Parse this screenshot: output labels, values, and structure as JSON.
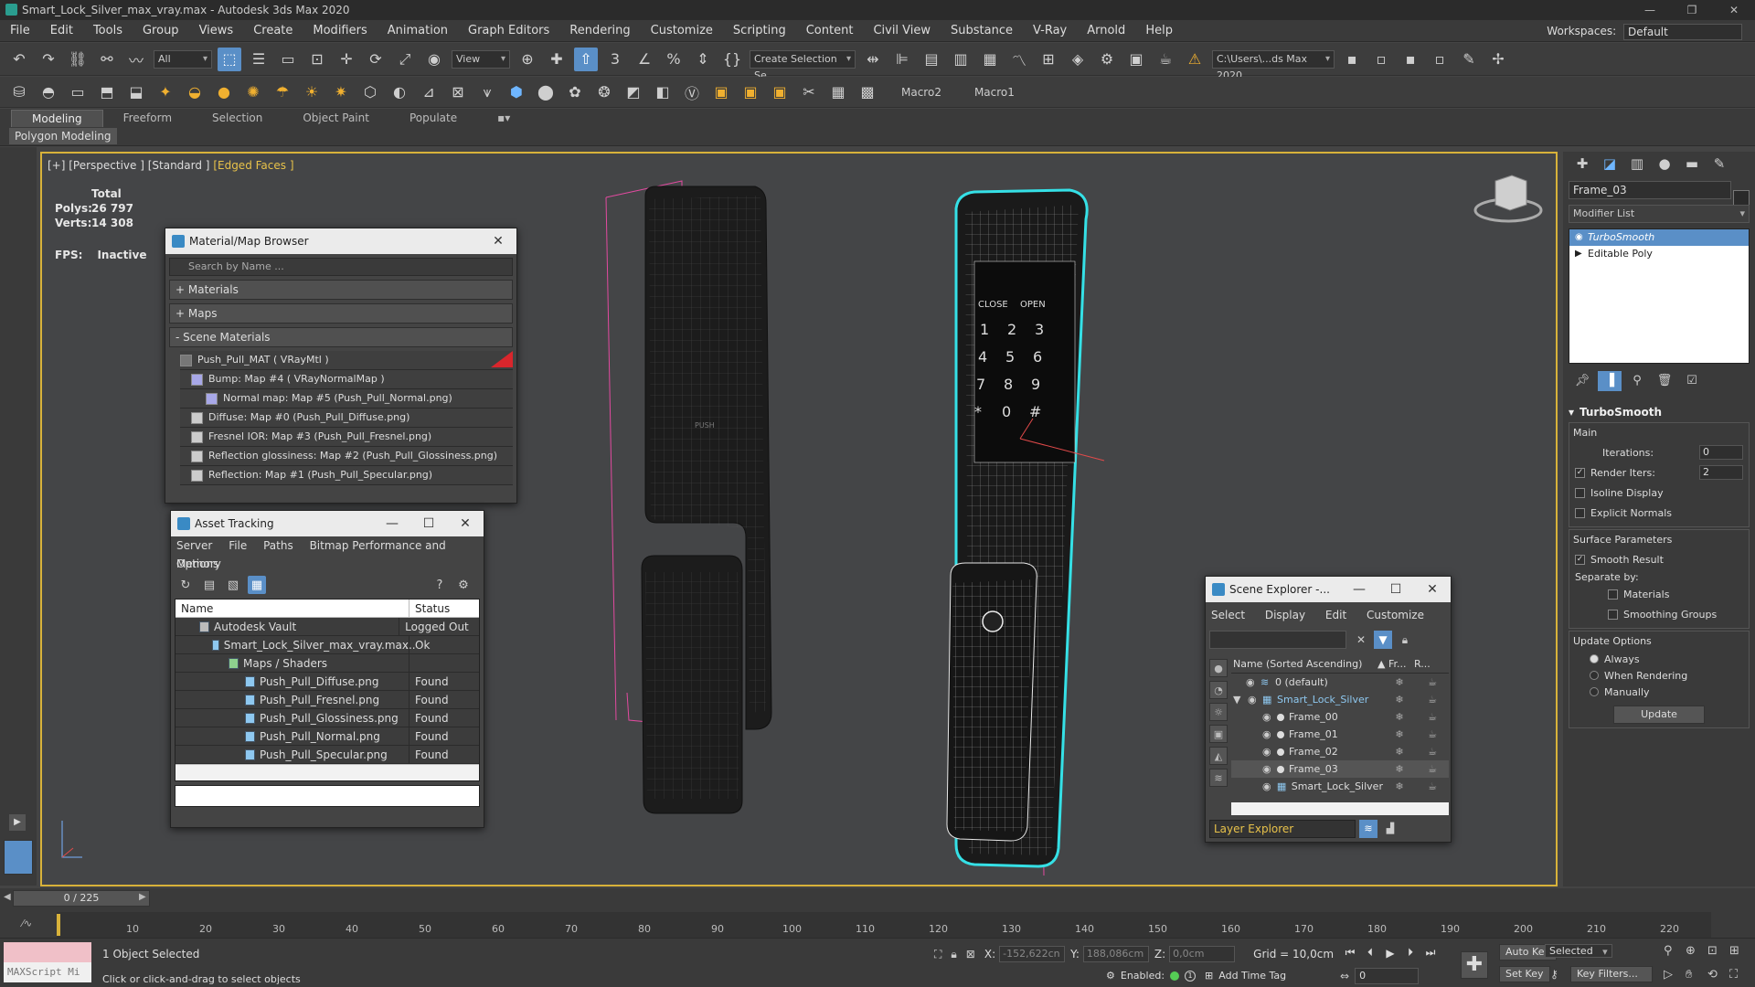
{
  "window": {
    "title": "Smart_Lock_Silver_max_vray.max - Autodesk 3ds Max 2020",
    "controls": [
      "—",
      "❐",
      "✕"
    ]
  },
  "menu": {
    "items": [
      "File",
      "Edit",
      "Tools",
      "Group",
      "Views",
      "Create",
      "Modifiers",
      "Animation",
      "Graph Editors",
      "Rendering",
      "Customize",
      "Scripting",
      "Content",
      "Civil View",
      "Substance",
      "V-Ray",
      "Arnold",
      "Help"
    ],
    "workspace_label": "Workspaces:",
    "workspace_value": "Default"
  },
  "toolbar": {
    "filter": "All",
    "view": "View",
    "selection_set": "Create Selection Se",
    "path": "C:\\Users\\...ds Max 2020",
    "macro1": "Macro2",
    "macro2": "Macro1"
  },
  "ribbon": {
    "tabs": [
      "Modeling",
      "Freeform",
      "Selection",
      "Object Paint",
      "Populate"
    ],
    "panel": "Polygon Modeling"
  },
  "viewport": {
    "label_prefix": "[+] [Perspective ] [Standard ] ",
    "label_mode": "[Edged Faces ]",
    "stats_title": "Total",
    "polys_label": "Polys:",
    "polys_value": "26 797",
    "verts_label": "Verts:",
    "verts_value": "14 308",
    "fps_label": "FPS:",
    "fps_value": "Inactive",
    "lock_labels": [
      "PUSH",
      "CLOSE",
      "OPEN",
      "1",
      "2",
      "3",
      "4",
      "5",
      "6",
      "7",
      "8",
      "9",
      "*",
      "0",
      "#"
    ]
  },
  "material_browser": {
    "title": "Material/Map Browser",
    "search_placeholder": "Search by Name ...",
    "rollouts": [
      "+ Materials",
      "+ Maps",
      "- Scene Materials"
    ],
    "items": [
      "Push_Pull_MAT ( VRayMtl )",
      "Bump: Map #4 ( VRayNormalMap )",
      "Normal map: Map #5 (Push_Pull_Normal.png)",
      "Diffuse: Map #0 (Push_Pull_Diffuse.png)",
      "Fresnel IOR: Map #3 (Push_Pull_Fresnel.png)",
      "Reflection glossiness: Map #2 (Push_Pull_Glossiness.png)",
      "Reflection: Map #1 (Push_Pull_Specular.png)"
    ]
  },
  "asset_tracking": {
    "title": "Asset Tracking",
    "menu": [
      "Server",
      "File",
      "Paths",
      "Bitmap Performance and Memory"
    ],
    "menu2": "Options",
    "col_name": "Name",
    "col_status": "Status",
    "rows": [
      {
        "name": "Autodesk Vault",
        "status": "Logged Out ..."
      },
      {
        "name": "Smart_Lock_Silver_max_vray.max",
        "status": "Ok"
      },
      {
        "name": "Maps / Shaders",
        "status": ""
      },
      {
        "name": "Push_Pull_Diffuse.png",
        "status": "Found"
      },
      {
        "name": "Push_Pull_Fresnel.png",
        "status": "Found"
      },
      {
        "name": "Push_Pull_Glossiness.png",
        "status": "Found"
      },
      {
        "name": "Push_Pull_Normal.png",
        "status": "Found"
      },
      {
        "name": "Push_Pull_Specular.png",
        "status": "Found"
      }
    ]
  },
  "scene_explorer": {
    "title": "Scene Explorer -...",
    "menu": [
      "Select",
      "Display",
      "Edit",
      "Customize"
    ],
    "col_name": "Name (Sorted Ascending)",
    "col_fr": "▲ Fr...",
    "col_r": "R...",
    "rows": [
      {
        "name": "0 (default)",
        "indent": 1
      },
      {
        "name": "Smart_Lock_Silver",
        "indent": 1
      },
      {
        "name": "Frame_00",
        "indent": 2
      },
      {
        "name": "Frame_01",
        "indent": 2
      },
      {
        "name": "Frame_02",
        "indent": 2
      },
      {
        "name": "Frame_03",
        "indent": 2
      },
      {
        "name": "Smart_Lock_Silver",
        "indent": 2
      }
    ],
    "footer": "Layer Explorer"
  },
  "command_panel": {
    "object_name": "Frame_03",
    "modifier_list": "Modifier List",
    "stack": [
      "TurboSmooth",
      "Editable Poly"
    ],
    "rollout_title": "TurboSmooth",
    "main_label": "Main",
    "iterations_label": "Iterations:",
    "iterations_value": "0",
    "render_iters_label": "Render Iters:",
    "render_iters_value": "2",
    "isoline": "Isoline Display",
    "explicit_normals": "Explicit Normals",
    "surface_params": "Surface Parameters",
    "smooth_result": "Smooth Result",
    "separate_by": "Separate by:",
    "materials": "Materials",
    "smoothing_groups": "Smoothing Groups",
    "update_options": "Update Options",
    "always": "Always",
    "when_rendering": "When Rendering",
    "manually": "Manually",
    "update_btn": "Update"
  },
  "timeline": {
    "slider": "0 / 225",
    "ticks": [
      "10",
      "20",
      "30",
      "40",
      "50",
      "60",
      "70",
      "80",
      "90",
      "100",
      "110",
      "120",
      "130",
      "140",
      "150",
      "160",
      "170",
      "180",
      "190",
      "200",
      "210",
      "220"
    ]
  },
  "status": {
    "maxscript": "MAXScript Mi",
    "selected": "1 Object Selected",
    "hint": "Click or click-and-drag to select objects",
    "x_label": "X:",
    "x_value": "-152,622cn",
    "y_label": "Y:",
    "y_value": "188,086cm",
    "z_label": "Z:",
    "z_value": "0,0cm",
    "grid": "Grid = 10,0cm",
    "enabled": "Enabled:",
    "add_time_tag": "Add Time Tag",
    "auto_key": "Auto Key",
    "set_key": "Set Key",
    "selected_ddl": "Selected",
    "key_filters": "Key Filters...",
    "frame": "0"
  }
}
